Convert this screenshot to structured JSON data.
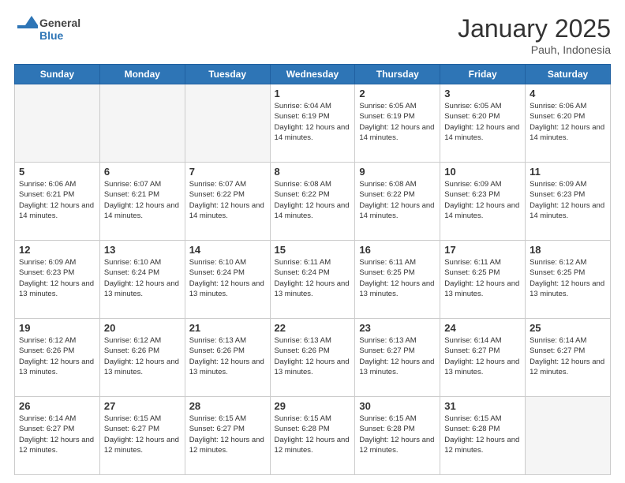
{
  "header": {
    "logo_general": "General",
    "logo_blue": "Blue",
    "month_title": "January 2025",
    "location": "Pauh, Indonesia"
  },
  "days_of_week": [
    "Sunday",
    "Monday",
    "Tuesday",
    "Wednesday",
    "Thursday",
    "Friday",
    "Saturday"
  ],
  "weeks": [
    [
      {
        "day": "",
        "empty": true
      },
      {
        "day": "",
        "empty": true
      },
      {
        "day": "",
        "empty": true
      },
      {
        "day": "1",
        "sunrise": "6:04 AM",
        "sunset": "6:19 PM",
        "daylight": "12 hours and 14 minutes."
      },
      {
        "day": "2",
        "sunrise": "6:05 AM",
        "sunset": "6:19 PM",
        "daylight": "12 hours and 14 minutes."
      },
      {
        "day": "3",
        "sunrise": "6:05 AM",
        "sunset": "6:20 PM",
        "daylight": "12 hours and 14 minutes."
      },
      {
        "day": "4",
        "sunrise": "6:06 AM",
        "sunset": "6:20 PM",
        "daylight": "12 hours and 14 minutes."
      }
    ],
    [
      {
        "day": "5",
        "sunrise": "6:06 AM",
        "sunset": "6:21 PM",
        "daylight": "12 hours and 14 minutes."
      },
      {
        "day": "6",
        "sunrise": "6:07 AM",
        "sunset": "6:21 PM",
        "daylight": "12 hours and 14 minutes."
      },
      {
        "day": "7",
        "sunrise": "6:07 AM",
        "sunset": "6:22 PM",
        "daylight": "12 hours and 14 minutes."
      },
      {
        "day": "8",
        "sunrise": "6:08 AM",
        "sunset": "6:22 PM",
        "daylight": "12 hours and 14 minutes."
      },
      {
        "day": "9",
        "sunrise": "6:08 AM",
        "sunset": "6:22 PM",
        "daylight": "12 hours and 14 minutes."
      },
      {
        "day": "10",
        "sunrise": "6:09 AM",
        "sunset": "6:23 PM",
        "daylight": "12 hours and 14 minutes."
      },
      {
        "day": "11",
        "sunrise": "6:09 AM",
        "sunset": "6:23 PM",
        "daylight": "12 hours and 14 minutes."
      }
    ],
    [
      {
        "day": "12",
        "sunrise": "6:09 AM",
        "sunset": "6:23 PM",
        "daylight": "12 hours and 13 minutes."
      },
      {
        "day": "13",
        "sunrise": "6:10 AM",
        "sunset": "6:24 PM",
        "daylight": "12 hours and 13 minutes."
      },
      {
        "day": "14",
        "sunrise": "6:10 AM",
        "sunset": "6:24 PM",
        "daylight": "12 hours and 13 minutes."
      },
      {
        "day": "15",
        "sunrise": "6:11 AM",
        "sunset": "6:24 PM",
        "daylight": "12 hours and 13 minutes."
      },
      {
        "day": "16",
        "sunrise": "6:11 AM",
        "sunset": "6:25 PM",
        "daylight": "12 hours and 13 minutes."
      },
      {
        "day": "17",
        "sunrise": "6:11 AM",
        "sunset": "6:25 PM",
        "daylight": "12 hours and 13 minutes."
      },
      {
        "day": "18",
        "sunrise": "6:12 AM",
        "sunset": "6:25 PM",
        "daylight": "12 hours and 13 minutes."
      }
    ],
    [
      {
        "day": "19",
        "sunrise": "6:12 AM",
        "sunset": "6:26 PM",
        "daylight": "12 hours and 13 minutes."
      },
      {
        "day": "20",
        "sunrise": "6:12 AM",
        "sunset": "6:26 PM",
        "daylight": "12 hours and 13 minutes."
      },
      {
        "day": "21",
        "sunrise": "6:13 AM",
        "sunset": "6:26 PM",
        "daylight": "12 hours and 13 minutes."
      },
      {
        "day": "22",
        "sunrise": "6:13 AM",
        "sunset": "6:26 PM",
        "daylight": "12 hours and 13 minutes."
      },
      {
        "day": "23",
        "sunrise": "6:13 AM",
        "sunset": "6:27 PM",
        "daylight": "12 hours and 13 minutes."
      },
      {
        "day": "24",
        "sunrise": "6:14 AM",
        "sunset": "6:27 PM",
        "daylight": "12 hours and 13 minutes."
      },
      {
        "day": "25",
        "sunrise": "6:14 AM",
        "sunset": "6:27 PM",
        "daylight": "12 hours and 12 minutes."
      }
    ],
    [
      {
        "day": "26",
        "sunrise": "6:14 AM",
        "sunset": "6:27 PM",
        "daylight": "12 hours and 12 minutes."
      },
      {
        "day": "27",
        "sunrise": "6:15 AM",
        "sunset": "6:27 PM",
        "daylight": "12 hours and 12 minutes."
      },
      {
        "day": "28",
        "sunrise": "6:15 AM",
        "sunset": "6:27 PM",
        "daylight": "12 hours and 12 minutes."
      },
      {
        "day": "29",
        "sunrise": "6:15 AM",
        "sunset": "6:28 PM",
        "daylight": "12 hours and 12 minutes."
      },
      {
        "day": "30",
        "sunrise": "6:15 AM",
        "sunset": "6:28 PM",
        "daylight": "12 hours and 12 minutes."
      },
      {
        "day": "31",
        "sunrise": "6:15 AM",
        "sunset": "6:28 PM",
        "daylight": "12 hours and 12 minutes."
      },
      {
        "day": "",
        "empty": true
      }
    ]
  ]
}
